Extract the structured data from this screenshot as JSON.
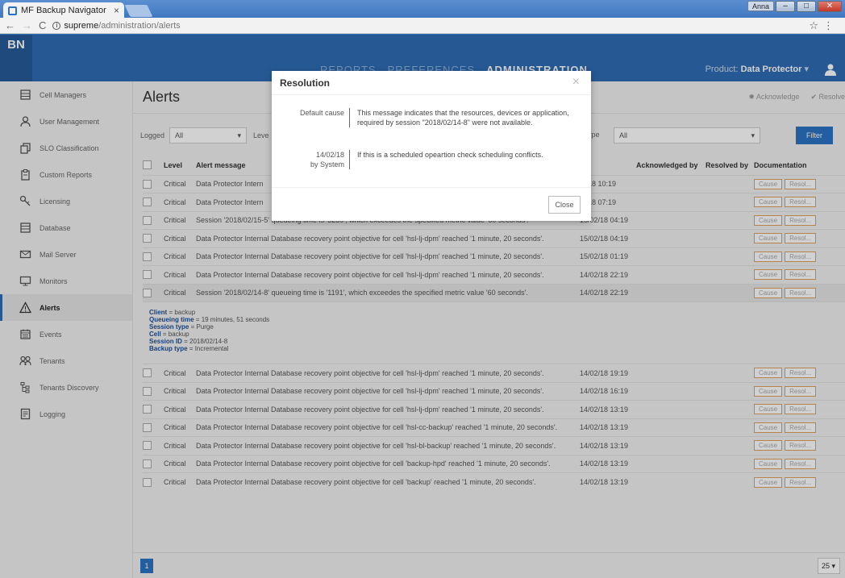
{
  "browser": {
    "tab_title": "MF Backup Navigator",
    "tab_close": "×",
    "url_host": "supreme",
    "url_path": "/administration/alerts",
    "window_user": "Anna"
  },
  "header": {
    "logo": "BN",
    "nav": [
      "REPORTS",
      "PREFERENCES",
      "ADMINISTRATION"
    ],
    "product_label": "Product:",
    "product_value": "Data Protector",
    "product_caret": "▾"
  },
  "sidebar": {
    "items": [
      {
        "label": "Cell Managers",
        "icon": "server-icon"
      },
      {
        "label": "User Management",
        "icon": "user-icon"
      },
      {
        "label": "SLO Classification",
        "icon": "copy-icon"
      },
      {
        "label": "Custom Reports",
        "icon": "clipboard-icon"
      },
      {
        "label": "Licensing",
        "icon": "key-icon"
      },
      {
        "label": "Database",
        "icon": "database-icon"
      },
      {
        "label": "Mail Server",
        "icon": "mail-icon"
      },
      {
        "label": "Monitors",
        "icon": "monitor-icon"
      },
      {
        "label": "Alerts",
        "icon": "warning-icon"
      },
      {
        "label": "Events",
        "icon": "calendar-icon"
      },
      {
        "label": "Tenants",
        "icon": "group-icon"
      },
      {
        "label": "Tenants Discovery",
        "icon": "hierarchy-icon"
      },
      {
        "label": "Logging",
        "icon": "log-icon"
      }
    ]
  },
  "page": {
    "title": "Alerts",
    "acknowledge": "Acknowledge",
    "resolve": "Resolve"
  },
  "filters": {
    "logged_label": "Logged",
    "logged_value": "All",
    "level_label": "Leve",
    "type_label": "Type",
    "type_value": "All",
    "filter_button": "Filter"
  },
  "table": {
    "headers": {
      "level": "Level",
      "message": "Alert message",
      "created": "ted",
      "acknowledged": "Acknowledged by",
      "resolved": "Resolved by",
      "documentation": "Documentation"
    },
    "cause_label": "Cause",
    "resol_label": "Resol...",
    "rows": [
      {
        "level": "Critical",
        "message": "Data Protector Intern",
        "date": "/2/18 10:19"
      },
      {
        "level": "Critical",
        "message": "Data Protector Intern",
        "date": "/2/18 07:19"
      },
      {
        "level": "Critical",
        "message": "Session '2018/02/15-5' queueing time is '3239', which exceedes the specified metric value '60 seconds'.",
        "date": "15/02/18 04:19"
      },
      {
        "level": "Critical",
        "message": "Data Protector Internal Database recovery point objective for cell 'hsl-lj-dpm' reached '1 minute, 20 seconds'.",
        "date": "15/02/18 04:19"
      },
      {
        "level": "Critical",
        "message": "Data Protector Internal Database recovery point objective for cell 'hsl-lj-dpm' reached '1 minute, 20 seconds'.",
        "date": "15/02/18 01:19"
      },
      {
        "level": "Critical",
        "message": "Data Protector Internal Database recovery point objective for cell 'hsl-lj-dpm' reached '1 minute, 20 seconds'.",
        "date": "14/02/18 22:19"
      },
      {
        "level": "Critical",
        "message": "Session '2018/02/14-8' queueing time is '1191', which exceedes the specified metric value '60 seconds'.",
        "date": "14/02/18 22:19"
      }
    ],
    "details": [
      {
        "key": "Client",
        "value": "backup"
      },
      {
        "key": "Queueing time",
        "value": "19 minutes, 51 seconds"
      },
      {
        "key": "Session type",
        "value": "Purge"
      },
      {
        "key": "Cell",
        "value": "backup"
      },
      {
        "key": "Session ID",
        "value": "2018/02/14-8"
      },
      {
        "key": "Backup type",
        "value": "Incremental"
      }
    ],
    "rows_after": [
      {
        "level": "Critical",
        "message": "Data Protector Internal Database recovery point objective for cell 'hsl-lj-dpm' reached '1 minute, 20 seconds'.",
        "date": "14/02/18 19:19"
      },
      {
        "level": "Critical",
        "message": "Data Protector Internal Database recovery point objective for cell 'hsl-lj-dpm' reached '1 minute, 20 seconds'.",
        "date": "14/02/18 16:19"
      },
      {
        "level": "Critical",
        "message": "Data Protector Internal Database recovery point objective for cell 'hsl-lj-dpm' reached '1 minute, 20 seconds'.",
        "date": "14/02/18 13:19"
      },
      {
        "level": "Critical",
        "message": "Data Protector Internal Database recovery point objective for cell 'hsl-cc-backup' reached '1 minute, 20 seconds'.",
        "date": "14/02/18 13:19"
      },
      {
        "level": "Critical",
        "message": "Data Protector Internal Database recovery point objective for cell 'hsl-bl-backup' reached '1 minute, 20 seconds'.",
        "date": "14/02/18 13:19"
      },
      {
        "level": "Critical",
        "message": "Data Protector Internal Database recovery point objective for cell 'backup-hpd' reached '1 minute, 20 seconds'.",
        "date": "14/02/18 13:19"
      },
      {
        "level": "Critical",
        "message": "Data Protector Internal Database recovery point objective for cell 'backup' reached '1 minute, 20 seconds'.",
        "date": "14/02/18 13:19"
      }
    ]
  },
  "pagination": {
    "current_page": "1",
    "per_page": "25"
  },
  "modal": {
    "title": "Resolution",
    "close_x": "×",
    "row1_label": "Default cause",
    "row1_text": "This message indicates that the resources, devices or application, required by session \"2018/02/14-8\" were not available.",
    "row2_label_date": "14/02/18",
    "row2_label_by": "by System",
    "row2_text": "If this is a scheduled opeartion check scheduling conflicts.",
    "close_button": "Close"
  }
}
